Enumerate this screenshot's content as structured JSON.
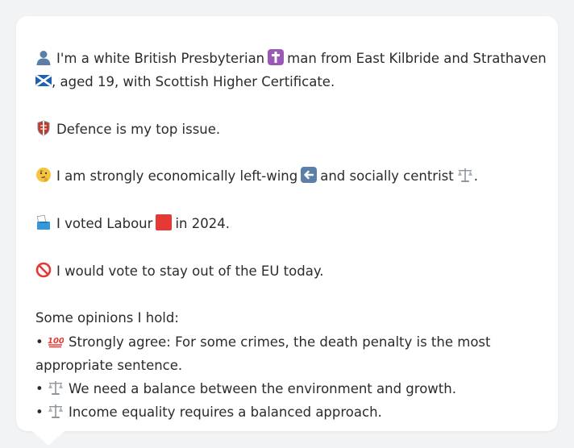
{
  "profile": {
    "line1_part1": "I'm a white British Presbyterian",
    "line1_part2": "man from East Kilbride and Strathaven",
    "line2": ", aged 19, with Scottish Higher Certificate.",
    "top_issue": "Defence is my top issue.",
    "economics_part1": "I am strongly economically left-wing",
    "economics_part2": "and socially centrist",
    "economics_end": ".",
    "vote_part1": "I voted Labour",
    "vote_part2": "in 2024.",
    "eu": "I would vote to stay out of the EU today."
  },
  "opinions": {
    "heading": "Some opinions I hold:",
    "bullet": "•",
    "items": [
      {
        "text_line1": "Strongly agree: For some crimes, the death penalty is the most",
        "text_line2": "appropriate sentence.",
        "icon": "hundred-points-icon"
      },
      {
        "text": "We need a balance between the environment and growth.",
        "icon": "balance-scale-icon"
      },
      {
        "text": "Income equality requires a balanced approach.",
        "icon": "balance-scale-icon"
      }
    ]
  },
  "icons": {
    "person": "person-icon",
    "cross": "latin-cross-icon",
    "flag": "scotland-flag-icon",
    "shield": "shield-icon",
    "thinking": "thinking-face-icon",
    "left_arrow": "left-arrow-icon",
    "scale": "balance-scale-icon",
    "ballot": "ballot-box-icon",
    "labour_square": "red-square-icon",
    "prohibited": "prohibited-icon",
    "hundred": "hundred-points-icon"
  },
  "colors": {
    "background": "#f2f3f5",
    "bubble": "#ffffff",
    "text": "#2b2b2b",
    "labour_red": "#e53935",
    "icon_blue": "#5b7fa6",
    "cross_purple": "#9b59b6"
  }
}
